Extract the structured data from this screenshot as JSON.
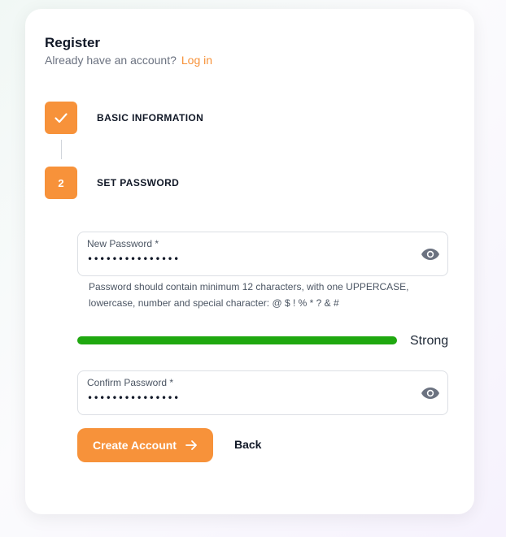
{
  "header": {
    "title": "Register",
    "subtitle": "Already have an account?",
    "login_link": "Log in"
  },
  "steps": [
    {
      "number": "",
      "label": "BASIC INFORMATION",
      "status": "completed",
      "icon": "check-icon"
    },
    {
      "number": "2",
      "label": "SET PASSWORD",
      "status": "active"
    }
  ],
  "new_password": {
    "label": "New Password *",
    "value": "•••••••••••••••",
    "toggle_icon": "eye-icon"
  },
  "hint": "Password should contain minimum 12 characters, with one UPPERCASE, lowercase, number and special character: @ $ ! % * ? & #",
  "strength": {
    "label": "Strong",
    "level": 1.0,
    "color": "#1fa80f"
  },
  "confirm_password": {
    "label": "Confirm Password *",
    "value": "•••••••••••••••",
    "toggle_icon": "eye-icon"
  },
  "actions": {
    "create_label": "Create Account",
    "create_icon": "arrow-right-icon",
    "back_label": "Back"
  },
  "colors": {
    "accent": "#f7923a",
    "strength_bar": "#1fa80f"
  }
}
